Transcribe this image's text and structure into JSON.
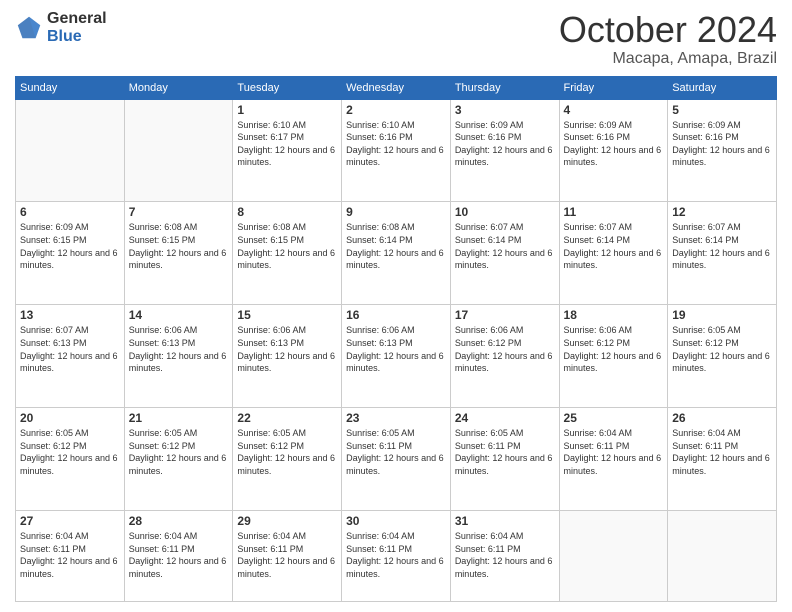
{
  "logo": {
    "general": "General",
    "blue": "Blue"
  },
  "header": {
    "month": "October 2024",
    "location": "Macapa, Amapa, Brazil"
  },
  "weekdays": [
    "Sunday",
    "Monday",
    "Tuesday",
    "Wednesday",
    "Thursday",
    "Friday",
    "Saturday"
  ],
  "weeks": [
    [
      {
        "day": "",
        "empty": true
      },
      {
        "day": "",
        "empty": true
      },
      {
        "day": "1",
        "sunrise": "Sunrise: 6:10 AM",
        "sunset": "Sunset: 6:17 PM",
        "daylight": "Daylight: 12 hours and 6 minutes."
      },
      {
        "day": "2",
        "sunrise": "Sunrise: 6:10 AM",
        "sunset": "Sunset: 6:16 PM",
        "daylight": "Daylight: 12 hours and 6 minutes."
      },
      {
        "day": "3",
        "sunrise": "Sunrise: 6:09 AM",
        "sunset": "Sunset: 6:16 PM",
        "daylight": "Daylight: 12 hours and 6 minutes."
      },
      {
        "day": "4",
        "sunrise": "Sunrise: 6:09 AM",
        "sunset": "Sunset: 6:16 PM",
        "daylight": "Daylight: 12 hours and 6 minutes."
      },
      {
        "day": "5",
        "sunrise": "Sunrise: 6:09 AM",
        "sunset": "Sunset: 6:16 PM",
        "daylight": "Daylight: 12 hours and 6 minutes."
      }
    ],
    [
      {
        "day": "6",
        "sunrise": "Sunrise: 6:09 AM",
        "sunset": "Sunset: 6:15 PM",
        "daylight": "Daylight: 12 hours and 6 minutes."
      },
      {
        "day": "7",
        "sunrise": "Sunrise: 6:08 AM",
        "sunset": "Sunset: 6:15 PM",
        "daylight": "Daylight: 12 hours and 6 minutes."
      },
      {
        "day": "8",
        "sunrise": "Sunrise: 6:08 AM",
        "sunset": "Sunset: 6:15 PM",
        "daylight": "Daylight: 12 hours and 6 minutes."
      },
      {
        "day": "9",
        "sunrise": "Sunrise: 6:08 AM",
        "sunset": "Sunset: 6:14 PM",
        "daylight": "Daylight: 12 hours and 6 minutes."
      },
      {
        "day": "10",
        "sunrise": "Sunrise: 6:07 AM",
        "sunset": "Sunset: 6:14 PM",
        "daylight": "Daylight: 12 hours and 6 minutes."
      },
      {
        "day": "11",
        "sunrise": "Sunrise: 6:07 AM",
        "sunset": "Sunset: 6:14 PM",
        "daylight": "Daylight: 12 hours and 6 minutes."
      },
      {
        "day": "12",
        "sunrise": "Sunrise: 6:07 AM",
        "sunset": "Sunset: 6:14 PM",
        "daylight": "Daylight: 12 hours and 6 minutes."
      }
    ],
    [
      {
        "day": "13",
        "sunrise": "Sunrise: 6:07 AM",
        "sunset": "Sunset: 6:13 PM",
        "daylight": "Daylight: 12 hours and 6 minutes."
      },
      {
        "day": "14",
        "sunrise": "Sunrise: 6:06 AM",
        "sunset": "Sunset: 6:13 PM",
        "daylight": "Daylight: 12 hours and 6 minutes."
      },
      {
        "day": "15",
        "sunrise": "Sunrise: 6:06 AM",
        "sunset": "Sunset: 6:13 PM",
        "daylight": "Daylight: 12 hours and 6 minutes."
      },
      {
        "day": "16",
        "sunrise": "Sunrise: 6:06 AM",
        "sunset": "Sunset: 6:13 PM",
        "daylight": "Daylight: 12 hours and 6 minutes."
      },
      {
        "day": "17",
        "sunrise": "Sunrise: 6:06 AM",
        "sunset": "Sunset: 6:12 PM",
        "daylight": "Daylight: 12 hours and 6 minutes."
      },
      {
        "day": "18",
        "sunrise": "Sunrise: 6:06 AM",
        "sunset": "Sunset: 6:12 PM",
        "daylight": "Daylight: 12 hours and 6 minutes."
      },
      {
        "day": "19",
        "sunrise": "Sunrise: 6:05 AM",
        "sunset": "Sunset: 6:12 PM",
        "daylight": "Daylight: 12 hours and 6 minutes."
      }
    ],
    [
      {
        "day": "20",
        "sunrise": "Sunrise: 6:05 AM",
        "sunset": "Sunset: 6:12 PM",
        "daylight": "Daylight: 12 hours and 6 minutes."
      },
      {
        "day": "21",
        "sunrise": "Sunrise: 6:05 AM",
        "sunset": "Sunset: 6:12 PM",
        "daylight": "Daylight: 12 hours and 6 minutes."
      },
      {
        "day": "22",
        "sunrise": "Sunrise: 6:05 AM",
        "sunset": "Sunset: 6:12 PM",
        "daylight": "Daylight: 12 hours and 6 minutes."
      },
      {
        "day": "23",
        "sunrise": "Sunrise: 6:05 AM",
        "sunset": "Sunset: 6:11 PM",
        "daylight": "Daylight: 12 hours and 6 minutes."
      },
      {
        "day": "24",
        "sunrise": "Sunrise: 6:05 AM",
        "sunset": "Sunset: 6:11 PM",
        "daylight": "Daylight: 12 hours and 6 minutes."
      },
      {
        "day": "25",
        "sunrise": "Sunrise: 6:04 AM",
        "sunset": "Sunset: 6:11 PM",
        "daylight": "Daylight: 12 hours and 6 minutes."
      },
      {
        "day": "26",
        "sunrise": "Sunrise: 6:04 AM",
        "sunset": "Sunset: 6:11 PM",
        "daylight": "Daylight: 12 hours and 6 minutes."
      }
    ],
    [
      {
        "day": "27",
        "sunrise": "Sunrise: 6:04 AM",
        "sunset": "Sunset: 6:11 PM",
        "daylight": "Daylight: 12 hours and 6 minutes."
      },
      {
        "day": "28",
        "sunrise": "Sunrise: 6:04 AM",
        "sunset": "Sunset: 6:11 PM",
        "daylight": "Daylight: 12 hours and 6 minutes."
      },
      {
        "day": "29",
        "sunrise": "Sunrise: 6:04 AM",
        "sunset": "Sunset: 6:11 PM",
        "daylight": "Daylight: 12 hours and 6 minutes."
      },
      {
        "day": "30",
        "sunrise": "Sunrise: 6:04 AM",
        "sunset": "Sunset: 6:11 PM",
        "daylight": "Daylight: 12 hours and 6 minutes."
      },
      {
        "day": "31",
        "sunrise": "Sunrise: 6:04 AM",
        "sunset": "Sunset: 6:11 PM",
        "daylight": "Daylight: 12 hours and 6 minutes."
      },
      {
        "day": "",
        "empty": true
      },
      {
        "day": "",
        "empty": true
      }
    ]
  ]
}
